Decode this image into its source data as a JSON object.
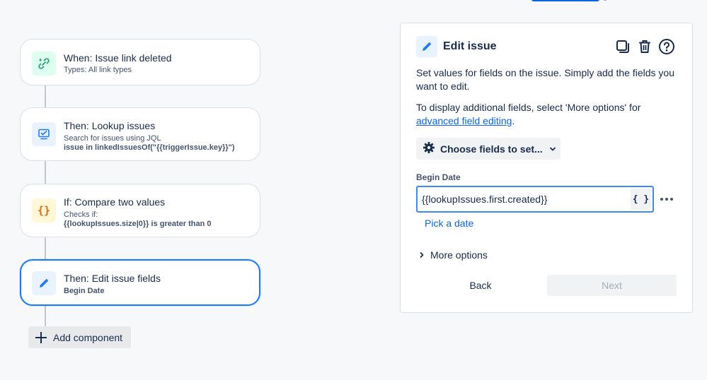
{
  "flow": {
    "cards": [
      {
        "icon": "link-broken-icon",
        "title": "When: Issue link deleted",
        "subtitle": "Types: All link types",
        "detail": ""
      },
      {
        "icon": "lookup-issues-icon",
        "title": "Then: Lookup issues",
        "subtitle": "Search for issues using JQL",
        "detail": "issue in linkedIssuesOf(\"{{triggerIssue.key}}\")"
      },
      {
        "icon": "curly-braces-icon",
        "title": "If: Compare two values",
        "subtitle": "Checks if:",
        "detail": "{{lookupIssues.size|0}} is greater than 0"
      },
      {
        "icon": "pencil-icon",
        "title": "Then: Edit issue fields",
        "subtitle": "",
        "detail": "Begin Date"
      }
    ],
    "add_component_label": "Add component"
  },
  "panel": {
    "title": "Edit issue",
    "desc1": "Set values for fields on the issue. Simply add the fields you want to edit.",
    "desc2_prefix": "To display additional fields, select 'More options' for",
    "desc2_link": "advanced field editing",
    "desc2_suffix": ".",
    "choose_fields_label": "Choose fields to set...",
    "field": {
      "label": "Begin Date",
      "value": "{{lookupIssues.first.created}}",
      "smart_value_label": "{ }"
    },
    "pick_date_label": "Pick a date",
    "more_options_label": "More options",
    "back_label": "Back",
    "next_label": "Next"
  },
  "colors": {
    "accent": "#0c66e4",
    "selected_border": "#1d7afc"
  }
}
